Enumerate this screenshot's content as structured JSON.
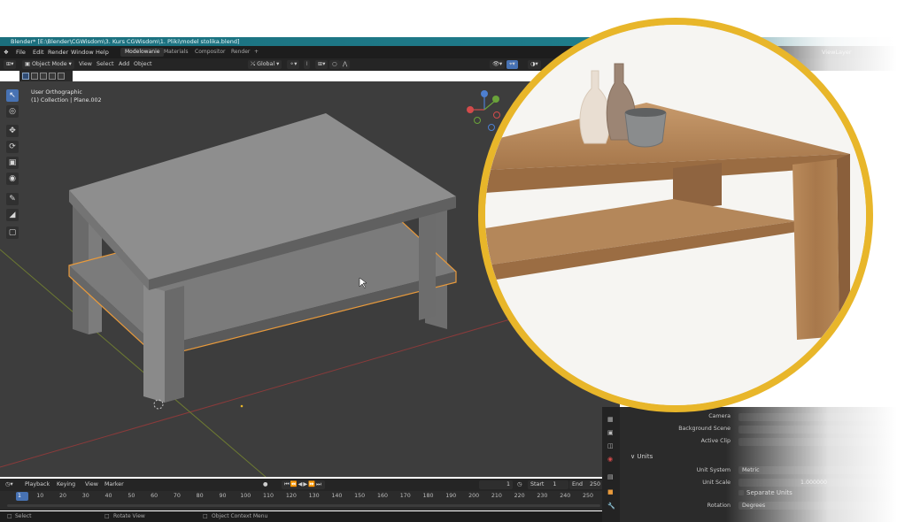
{
  "titlebar": {
    "title": "Blender* [E:\\Blender\\CGWisdom\\3. Kurs CGWisdom\\1. Pliki\\model stolika.blend]"
  },
  "menu": {
    "items": [
      "File",
      "Edit",
      "Render",
      "Window",
      "Help"
    ]
  },
  "workspaces": [
    {
      "label": "Modelowanie",
      "active": true
    },
    {
      "label": "Materials",
      "active": false
    },
    {
      "label": "Compositor",
      "active": false
    },
    {
      "label": "Render",
      "active": false
    }
  ],
  "workspace_add": "+",
  "header": {
    "mode": "Object Mode",
    "items": [
      "View",
      "Select",
      "Add",
      "Object"
    ],
    "orientation": "Global"
  },
  "viewport": {
    "view_name": "User Orthographic",
    "collection": "(1) Collection | Plane.002"
  },
  "gizmo": {
    "x": "X",
    "y": "Y",
    "z": "Z"
  },
  "viewlayer": "ViewLayer",
  "timeline": {
    "menus": [
      "Playback",
      "Keying",
      "View",
      "Marker"
    ],
    "current_frame": "1",
    "start_label": "Start",
    "start": "1",
    "end_label": "End",
    "end": "250",
    "ticks": [
      "1",
      "10",
      "20",
      "30",
      "40",
      "50",
      "60",
      "70",
      "80",
      "90",
      "100",
      "110",
      "120",
      "130",
      "140",
      "150",
      "160",
      "170",
      "180",
      "190",
      "200",
      "210",
      "220",
      "230",
      "240",
      "250"
    ]
  },
  "statusbar": {
    "select": "Select",
    "rotate": "Rotate View",
    "context": "Object Context Menu"
  },
  "properties": {
    "camera_label": "Camera",
    "background_label": "Background Scene",
    "active_clip_label": "Active Clip",
    "units_header": "Units",
    "unit_system_label": "Unit System",
    "unit_system_value": "Metric",
    "unit_scale_label": "Unit Scale",
    "unit_scale_value": "1.000000",
    "separate_units_label": "Separate Units",
    "rotation_label": "Rotation",
    "rotation_value": "Degrees"
  },
  "colors": {
    "accent": "#4772b3",
    "selection": "#e89a3c",
    "circle_border": "#e8b62a",
    "titlebar": "#1f7d8c"
  }
}
